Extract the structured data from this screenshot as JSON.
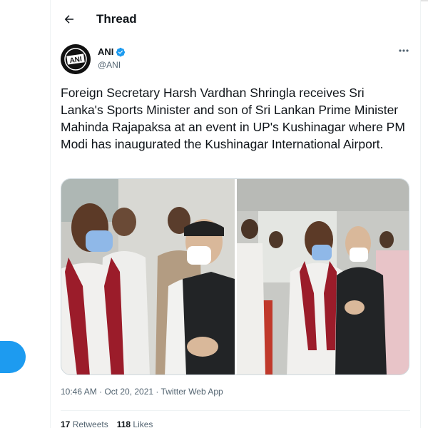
{
  "header": {
    "back_icon": "arrow-left-icon",
    "title": "Thread"
  },
  "tweet": {
    "author": {
      "name": "ANI",
      "handle": "@ANI",
      "verified_icon": "verified-badge-icon",
      "avatar_text": "ANI"
    },
    "more_icon": "more-horizontal-icon",
    "text": "Foreign Secretary Harsh Vardhan Shringla receives Sri Lanka's Sports Minister and son of Sri Lankan Prime Minister Mahinda Rajapaksa at an event in UP's Kushinagar where PM Modi has inaugurated the Kushinagar International Airport.",
    "photos": [
      {
        "subject": "photo-officials-greeting-1"
      },
      {
        "subject": "photo-officials-greeting-2"
      }
    ],
    "timestamp": "10:46 AM · Oct 20, 2021 · Twitter Web App",
    "stats": {
      "retweets_count": "17",
      "retweets_label": " Retweets",
      "likes_count": "118",
      "likes_label": " Likes"
    }
  },
  "colors": {
    "accent": "#1d9bf0",
    "text_primary": "#0f1419",
    "text_secondary": "#536471",
    "border": "#eff3f4"
  }
}
